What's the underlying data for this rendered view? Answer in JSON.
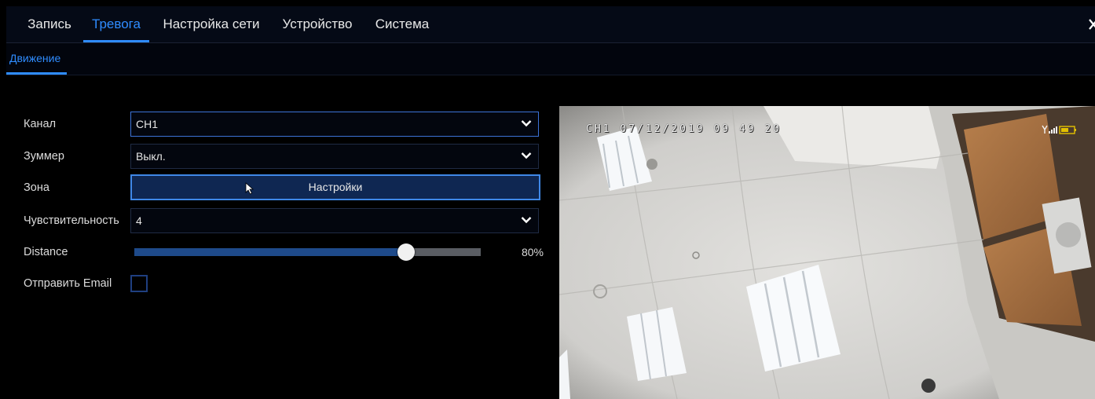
{
  "tabs": [
    {
      "label": "Запись",
      "active": false
    },
    {
      "label": "Тревога",
      "active": true
    },
    {
      "label": "Настройка сети",
      "active": false
    },
    {
      "label": "Устройство",
      "active": false
    },
    {
      "label": "Система",
      "active": false
    }
  ],
  "subtabs": [
    {
      "label": "Движение",
      "active": true
    }
  ],
  "form": {
    "channel": {
      "label": "Канал",
      "value": "CH1"
    },
    "buzzer": {
      "label": "Зуммер",
      "value": "Выкл."
    },
    "zone": {
      "label": "Зона",
      "button": "Настройки"
    },
    "sensitivity": {
      "label": "Чувствительность",
      "value": "4"
    },
    "distance": {
      "label": "Distance",
      "value": 80,
      "value_text": "80%"
    },
    "send_email": {
      "label": "Отправить Email",
      "checked": false
    }
  },
  "preview": {
    "osd_text": "CH1 07/12/2019 09 49 20",
    "status_icon": "signal-battery-icon"
  },
  "colors": {
    "accent": "#2f8cff",
    "slider_fill": "#1e4a8a",
    "background": "#000000"
  }
}
